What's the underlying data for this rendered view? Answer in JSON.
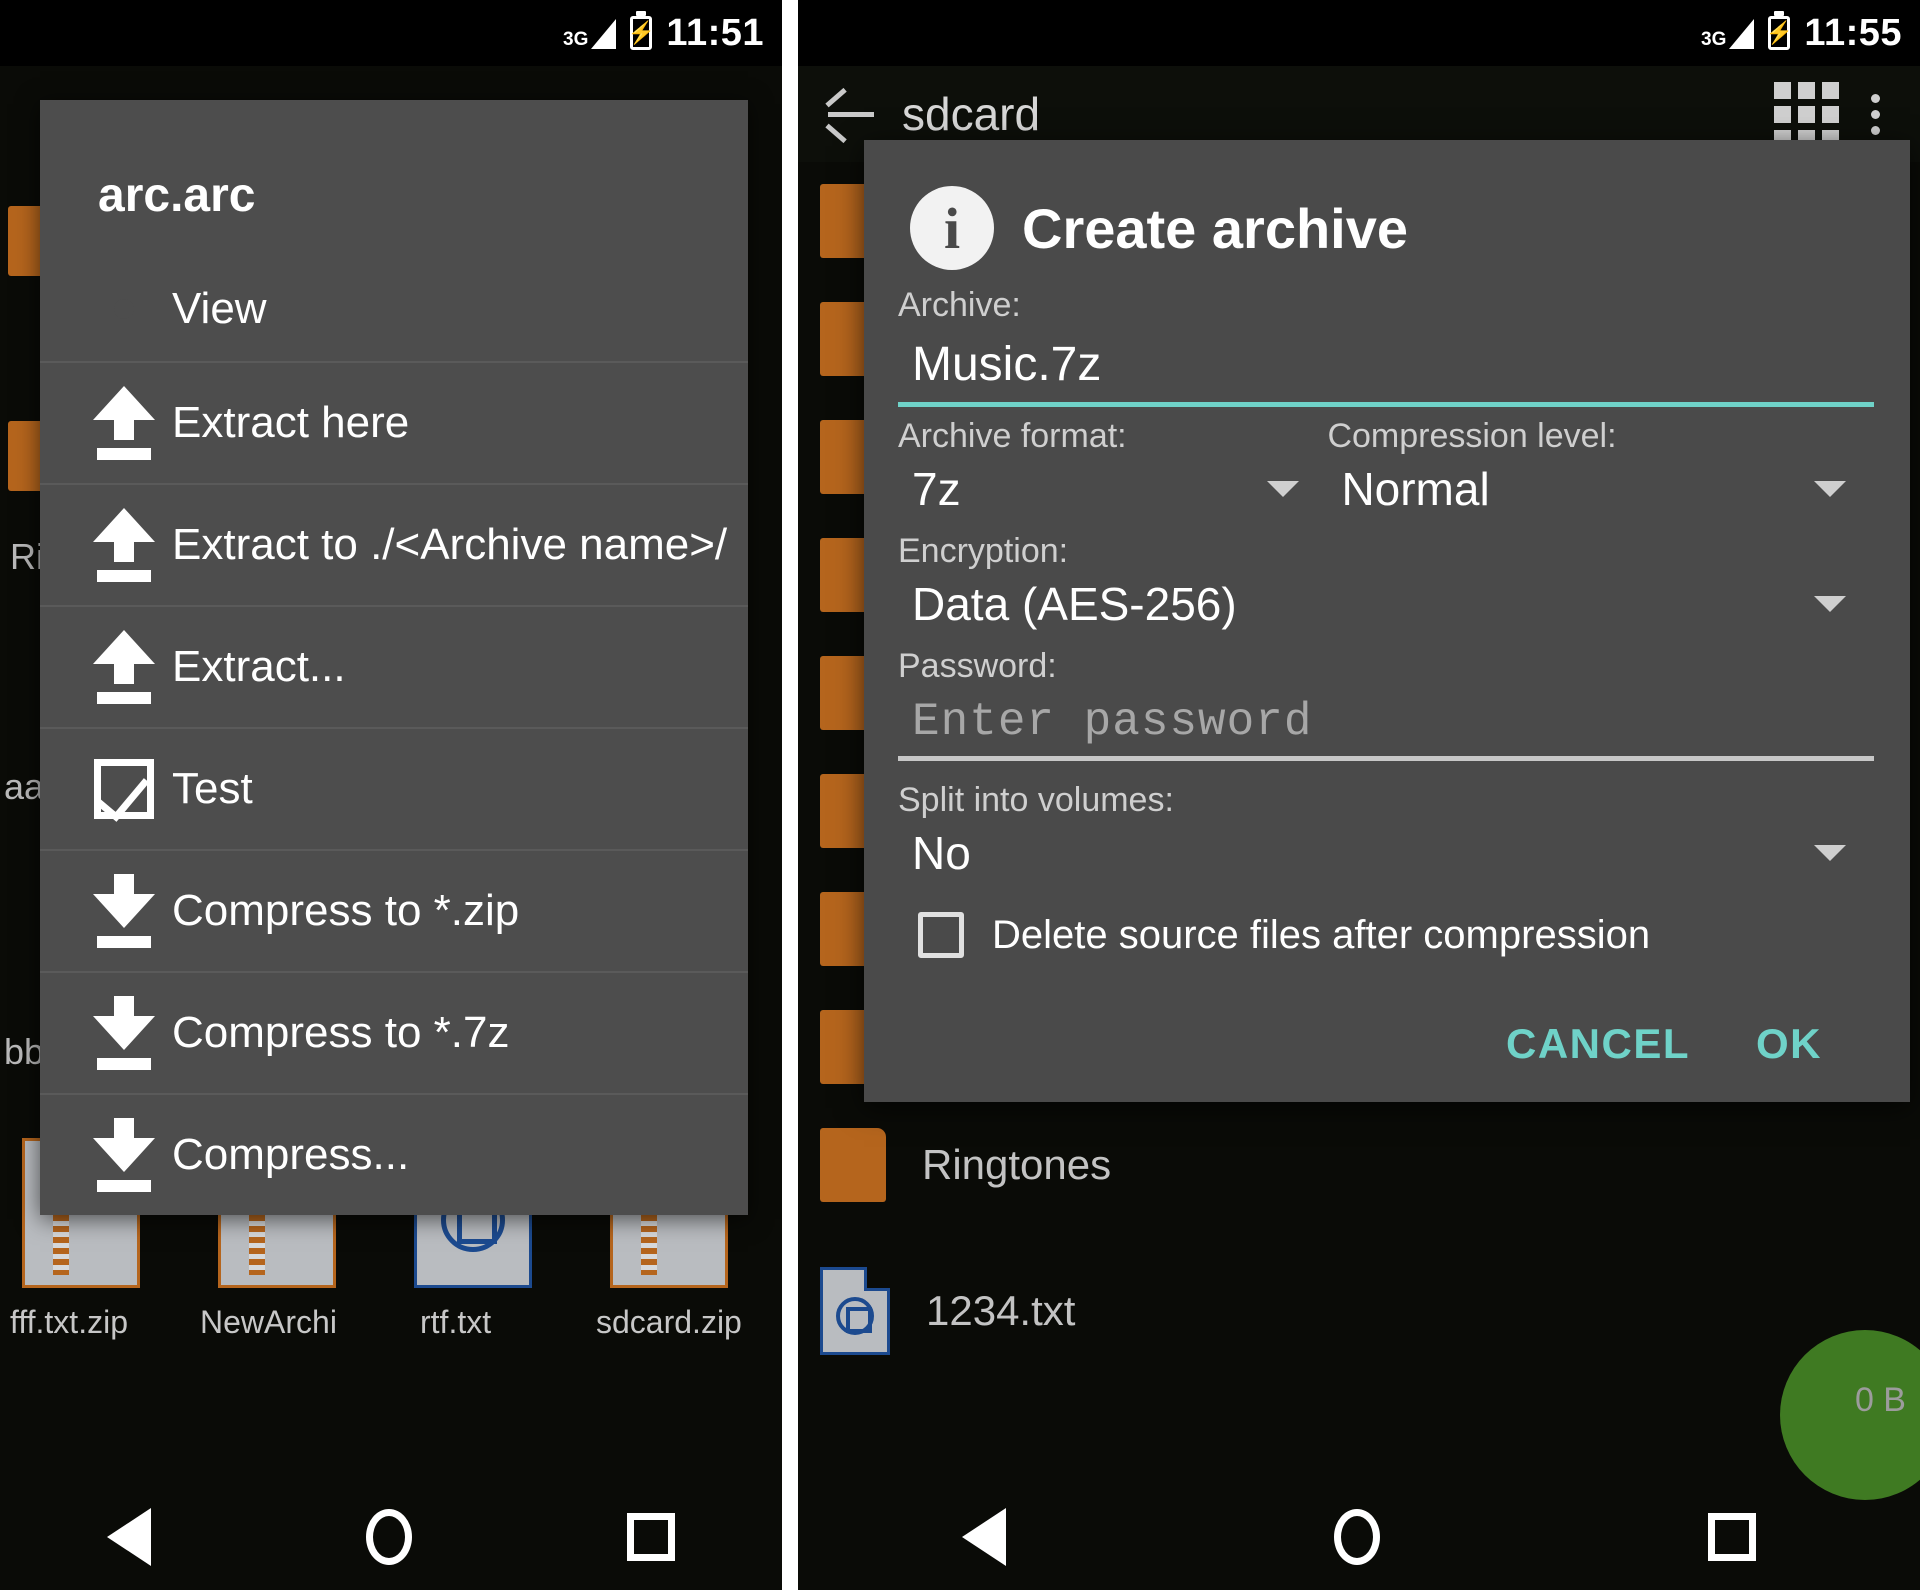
{
  "left_phone": {
    "statusbar": {
      "network": "3G",
      "time": "11:51"
    },
    "popup": {
      "title": "arc.arc",
      "items": [
        {
          "label": "View",
          "icon": "eye-icon"
        },
        {
          "label": "Extract here",
          "icon": "arrow-up-icon"
        },
        {
          "label": "Extract to ./<Archive name>/",
          "icon": "arrow-up-icon"
        },
        {
          "label": "Extract...",
          "icon": "arrow-up-icon"
        },
        {
          "label": "Test",
          "icon": "checkbox-check-icon"
        },
        {
          "label": "Compress to *.zip",
          "icon": "arrow-down-icon"
        },
        {
          "label": "Compress to *.7z",
          "icon": "arrow-down-icon"
        },
        {
          "label": "Compress...",
          "icon": "arrow-down-icon"
        }
      ]
    },
    "background": {
      "partial_labels": [
        "Rin",
        "aa",
        "bb"
      ],
      "file_captions": [
        "fff.txt.zip",
        "NewArchi",
        "rtf.txt",
        "sdcard.zip"
      ]
    },
    "navbar": {
      "back": "back-icon",
      "home": "home-icon",
      "recents": "recents-icon"
    }
  },
  "right_phone": {
    "statusbar": {
      "network": "3G",
      "time": "11:55"
    },
    "topbar": {
      "back": "back-arrow-icon",
      "breadcrumb": "sdcard",
      "grid": "grid-view-icon",
      "overflow": "more-vertical-icon"
    },
    "file_rows": [
      {
        "name": "Ringtones",
        "type": "folder"
      },
      {
        "name": "1234.txt",
        "type": "file"
      }
    ],
    "size_label": "0 B",
    "dialog": {
      "icon": "info-icon",
      "title": "Create archive",
      "archive_label": "Archive:",
      "archive_value": "Music.7z",
      "format_label": "Archive format:",
      "format_value": "7z",
      "compression_label": "Compression level:",
      "compression_value": "Normal",
      "encryption_label": "Encryption:",
      "encryption_value": "Data (AES-256)",
      "password_label": "Password:",
      "password_placeholder": "Enter password",
      "split_label": "Split into volumes:",
      "split_value": "No",
      "delete_source_label": "Delete source files after compression",
      "delete_source_checked": false,
      "cancel_label": "CANCEL",
      "ok_label": "OK"
    },
    "navbar": {
      "back": "back-icon",
      "home": "home-icon",
      "recents": "recents-icon"
    }
  },
  "colors": {
    "accent_teal": "#6fd2c8",
    "dialog_bg": "#4a4a4a",
    "popup_bg": "#4d4d4d",
    "folder_orange": "#b5651d",
    "file_blue": "#1c4a8f"
  }
}
